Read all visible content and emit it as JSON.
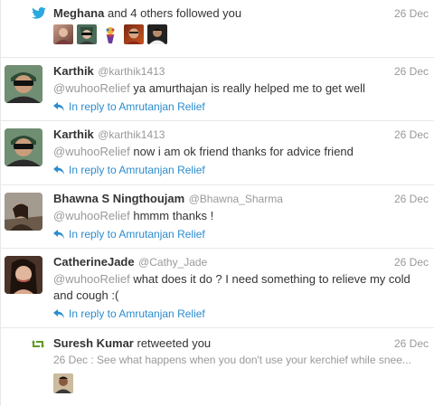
{
  "follow": {
    "name": "Meghana",
    "text": "and 4 others followed you",
    "date": "26 Dec"
  },
  "tweets": [
    {
      "name": "Karthik",
      "handle": "@karthik1413",
      "mention": "@wuhooRelief",
      "text": "ya amurthajan is really helped me to get well",
      "reply": "In reply to Amrutanjan Relief",
      "date": "26 Dec"
    },
    {
      "name": "Karthik",
      "handle": "@karthik1413",
      "mention": "@wuhooRelief",
      "text": "now i am ok friend thanks for advice friend",
      "reply": "In reply to Amrutanjan Relief",
      "date": "26 Dec"
    },
    {
      "name": "Bhawna S Ningthoujam",
      "handle": "@Bhawna_Sharma",
      "mention": "@wuhooRelief",
      "text": "hmmm thanks !",
      "reply": "In reply to Amrutanjan Relief",
      "date": "26 Dec"
    },
    {
      "name": "CatherineJade",
      "handle": "@Cathy_Jade",
      "mention": "@wuhooRelief",
      "text": "what does it do ? I need something to relieve my cold",
      "text2": "and cough :(",
      "reply": "In reply to Amrutanjan Relief",
      "date": "26 Dec"
    }
  ],
  "retweet": {
    "name": "Suresh Kumar",
    "text": "retweeted you",
    "date": "26 Dec",
    "snippet": "26 Dec : See what happens when you don't use your kerchief while snee..."
  },
  "colors": {
    "link": "#2a8ccf",
    "twitter_blue": "#2aa9e0",
    "retweet_green": "#609928",
    "muted": "#999999"
  }
}
